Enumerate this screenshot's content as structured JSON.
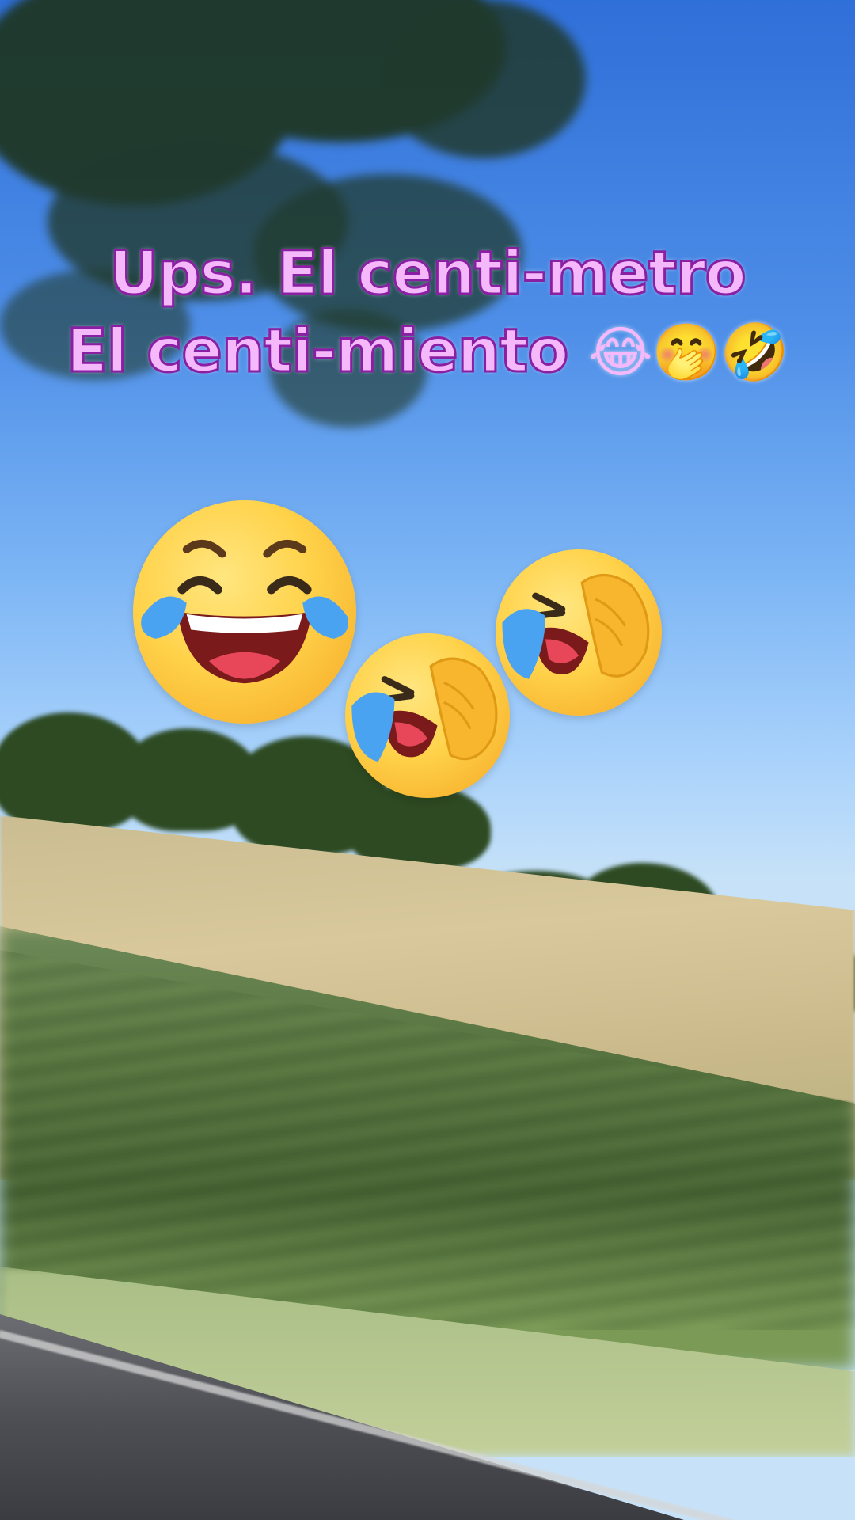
{
  "caption": {
    "line1": "Ups. El centi-metro",
    "line2_text": "El centi-miento ",
    "line2_emojis": [
      "😂",
      "🤭",
      "🤣"
    ],
    "text_color": "#f4b8fb",
    "outline_color": "#8a1fa3"
  },
  "stickers": [
    {
      "name": "face-with-tears-of-joy",
      "emoji": "😂"
    },
    {
      "name": "laughing-hand-over-face",
      "emoji": "🤭"
    },
    {
      "name": "laughing-hand-over-face",
      "emoji": "🤭"
    }
  ],
  "scene": {
    "sky_color": "#4f8fe8",
    "field_color": "#d8c89c",
    "grass_color": "#56733f",
    "road_color": "#4e4f55"
  }
}
